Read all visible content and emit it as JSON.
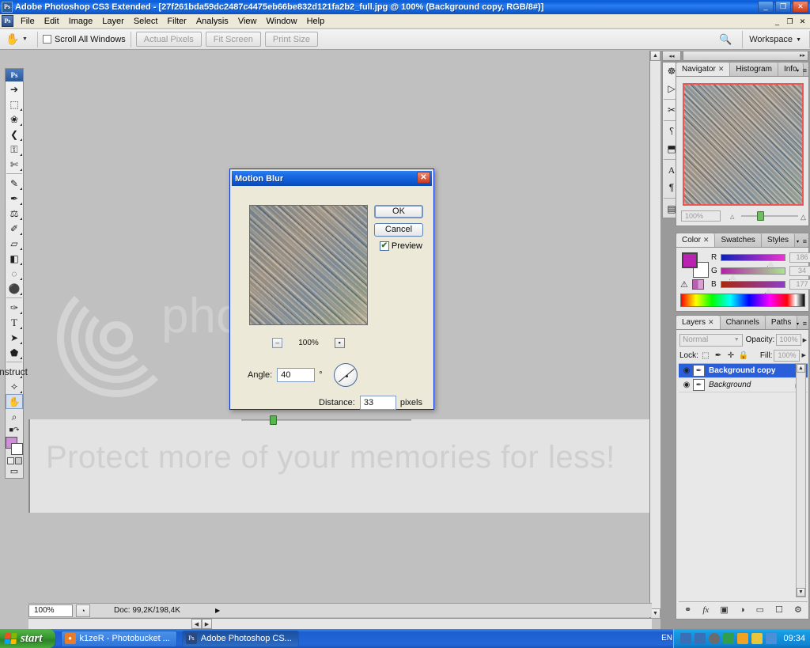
{
  "window": {
    "title": "Adobe Photoshop CS3 Extended - [27f261bda59dc2487c4475eb66be832d121fa2b2_full.jpg @ 100% (Background copy, RGB/8#)]",
    "app_icon": "Ps",
    "minimize": "_",
    "restore": "❐",
    "close": "✕"
  },
  "menubar": {
    "items": [
      "File",
      "Edit",
      "Image",
      "Layer",
      "Select",
      "Filter",
      "Analysis",
      "View",
      "Window",
      "Help"
    ],
    "doc_minimize": "_",
    "doc_restore": "❐",
    "doc_close": "✕"
  },
  "options_bar": {
    "tool_icon": "✋",
    "scroll_all_windows_label": "Scroll All Windows",
    "scroll_all_windows_checked": false,
    "buttons": [
      "Actual Pixels",
      "Fit Screen",
      "Print Size"
    ],
    "workspace_label": "Workspace",
    "workspace_caret": "▼"
  },
  "toolbox": {
    "logo": "Ps",
    "groups": [
      [
        {
          "name": "move-tool",
          "glyph": "↖",
          "has_menu": false
        },
        {
          "name": "rectangular-marquee-tool",
          "glyph": "⬚",
          "has_menu": true
        },
        {
          "name": "lasso-tool",
          "glyph": "❀",
          "has_menu": true
        },
        {
          "name": "magic-wand-tool",
          "glyph": "✦",
          "has_menu": true
        },
        {
          "name": "crop-tool",
          "glyph": "⌗",
          "has_menu": true
        },
        {
          "name": "slice-tool",
          "glyph": "✄",
          "has_menu": true
        }
      ],
      [
        {
          "name": "healing-brush-tool",
          "glyph": "✎",
          "has_menu": true
        },
        {
          "name": "brush-tool",
          "glyph": "✒",
          "has_menu": true
        },
        {
          "name": "clone-stamp-tool",
          "glyph": "⚑",
          "has_menu": true
        },
        {
          "name": "history-brush-tool",
          "glyph": "✐",
          "has_menu": true
        },
        {
          "name": "eraser-tool",
          "glyph": "▱",
          "has_menu": true
        },
        {
          "name": "gradient-tool",
          "glyph": "◧",
          "has_menu": true
        },
        {
          "name": "blur-tool",
          "glyph": "◍",
          "has_menu": true
        },
        {
          "name": "dodge-tool",
          "glyph": "⚫",
          "has_menu": true
        }
      ],
      [
        {
          "name": "pen-tool",
          "glyph": "✑",
          "has_menu": true
        },
        {
          "name": "type-tool",
          "glyph": "T",
          "has_menu": true
        },
        {
          "name": "path-selection-tool",
          "glyph": "➤",
          "has_menu": true
        },
        {
          "name": "custom-shape-tool",
          "glyph": "⬟",
          "has_menu": true
        }
      ],
      [
        {
          "name": "notes-tool",
          "glyph": "▤",
          "has_menu": true
        },
        {
          "name": "eyedropper-tool",
          "glyph": "⚗",
          "has_menu": true
        },
        {
          "name": "hand-tool",
          "glyph": "✋",
          "has_menu": false,
          "selected": true
        },
        {
          "name": "zoom-tool",
          "glyph": "⌕",
          "has_menu": false
        }
      ]
    ],
    "swap_colors_glyph": "↰",
    "foreground_color": "#cf8fd8",
    "background_color": "#ffffff",
    "quickmask_glyphs": [
      "□",
      "▣"
    ],
    "screenmode_glyph": "▭"
  },
  "document": {
    "watermark_line": "Protect more of your memories for less!",
    "watermark_brand": "photobucke",
    "canvas_bg": "#c0c0c0",
    "image_strip_bg": "#e3e3e3"
  },
  "status_bar": {
    "zoom": "100%",
    "thumb_icon": "◔",
    "doc_info": "Doc: 99,2K/198,4K",
    "play_glyph": "▶",
    "resize_glyph": "◢"
  },
  "dock_strip": {
    "grip_glyph": "◂◂",
    "expand_glyph": "▸▸",
    "icons": [
      {
        "name": "bridge-icon",
        "glyph": "❐"
      },
      {
        "name": "actions-icon",
        "glyph": "▷"
      },
      {
        "name": "tool-presets-icon",
        "glyph": "✂"
      },
      {
        "name": "brushes-icon",
        "glyph": "⸮"
      },
      {
        "name": "clone-source-icon",
        "glyph": "⬒"
      },
      {
        "name": "character-icon",
        "glyph": "A"
      },
      {
        "name": "paragraph-icon",
        "glyph": "¶"
      },
      {
        "name": "layer-comps-icon",
        "glyph": "▤"
      }
    ]
  },
  "navigator_panel": {
    "tabs": [
      {
        "label": "Navigator",
        "active": true,
        "closable": true
      },
      {
        "label": "Histogram",
        "active": false,
        "closable": false
      },
      {
        "label": "Info",
        "active": false,
        "closable": false
      }
    ],
    "zoom_value": "100%",
    "view_box_color": "#ef5656",
    "menu_glyph": "≡",
    "collapse_glyph": "–",
    "close_glyph": "✕",
    "small_mountain": "▲",
    "large_mountain": "▲▲"
  },
  "color_panel": {
    "tabs": [
      {
        "label": "Color",
        "active": true,
        "closable": true
      },
      {
        "label": "Swatches",
        "active": false,
        "closable": false
      },
      {
        "label": "Styles",
        "active": false,
        "closable": false
      }
    ],
    "foreground_color": "#ba22b1",
    "background_color": "#ffffff",
    "out_of_gamut_glyph": "⚠",
    "channels": [
      {
        "label": "R",
        "value": "186",
        "pct": 73
      },
      {
        "label": "G",
        "value": "34",
        "pct": 13
      },
      {
        "label": "B",
        "value": "177",
        "pct": 69
      }
    ],
    "menu_glyph": "≡",
    "collapse_glyph": "–",
    "close_glyph": "✕"
  },
  "layers_panel": {
    "tabs": [
      {
        "label": "Layers",
        "active": true,
        "closable": true
      },
      {
        "label": "Channels",
        "active": false,
        "closable": false
      },
      {
        "label": "Paths",
        "active": false,
        "closable": false
      }
    ],
    "blend_mode": "Normal",
    "blend_caret": "▼",
    "opacity_label": "Opacity:",
    "opacity_value": "100%",
    "opacity_caret": "▶",
    "lock_label": "Lock:",
    "lock_icons": [
      {
        "name": "lock-transparent-icon",
        "glyph": "⬚"
      },
      {
        "name": "lock-image-icon",
        "glyph": "✒"
      },
      {
        "name": "lock-position-icon",
        "glyph": "✛"
      },
      {
        "name": "lock-all-icon",
        "glyph": "🔒"
      }
    ],
    "fill_label": "Fill:",
    "fill_value": "100%",
    "fill_caret": "▶",
    "rows": [
      {
        "name": "Background copy",
        "selected": true,
        "visible": true,
        "locked": false,
        "italic": false
      },
      {
        "name": "Background",
        "selected": false,
        "visible": true,
        "locked": true,
        "italic": true
      }
    ],
    "eye_glyph": "◉",
    "thumb_glyph": "✒",
    "lock_glyph": "🔒",
    "bottom_icons": [
      {
        "name": "link-layers-icon",
        "glyph": "⚭"
      },
      {
        "name": "layer-style-icon",
        "glyph": "fx"
      },
      {
        "name": "layer-mask-icon",
        "glyph": "▣"
      },
      {
        "name": "adjustment-layer-icon",
        "glyph": "◑"
      },
      {
        "name": "new-group-icon",
        "glyph": "▭"
      },
      {
        "name": "new-layer-icon",
        "glyph": "❐"
      },
      {
        "name": "delete-layer-icon",
        "glyph": "🗑"
      }
    ],
    "menu_glyph": "≡",
    "collapse_glyph": "–",
    "close_glyph": "✕"
  },
  "motion_blur_dialog": {
    "title": "Motion Blur",
    "close_glyph": "✕",
    "ok_label": "OK",
    "cancel_label": "Cancel",
    "preview_label": "Preview",
    "preview_checked": true,
    "preview_check_glyph": "✔",
    "zoom_out_glyph": "–",
    "zoom_in_glyph": "▪",
    "zoom_level": "100%",
    "angle_label": "Angle:",
    "angle_value": "40",
    "degree_symbol": "°",
    "distance_label": "Distance:",
    "distance_value": "33",
    "distance_units": "pixels"
  },
  "taskbar": {
    "start_label": "start",
    "items": [
      {
        "name": "taskbar-item-firefox",
        "label": "k1zeR - Photobucket ...",
        "icon_glyph": "●",
        "icon_color": "#e87c28"
      },
      {
        "name": "taskbar-item-photoshop",
        "label": "Adobe Photoshop CS...",
        "icon_glyph": "Ps",
        "icon_color": "#29497f",
        "active": true
      }
    ],
    "language": "EN",
    "tray_icons": [
      {
        "name": "network-icon",
        "color": "#3a6fb5"
      },
      {
        "name": "network-2-icon",
        "color": "#3a6fb5"
      },
      {
        "name": "volume-icon",
        "color": "#6b6b6b"
      },
      {
        "name": "antivirus-icon",
        "color": "#2f9e4f"
      },
      {
        "name": "messenger-icon",
        "color": "#f0a323"
      },
      {
        "name": "updater-icon",
        "color": "#e8c53a"
      },
      {
        "name": "system-icon",
        "color": "#4a8fd8"
      }
    ],
    "clock": "09:34"
  }
}
